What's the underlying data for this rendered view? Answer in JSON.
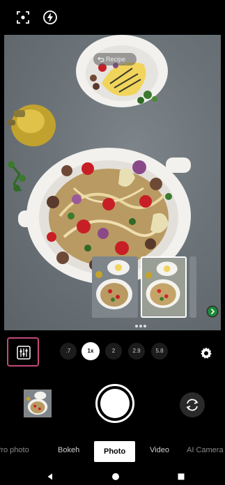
{
  "top_bar": {
    "icons": [
      "focus-frame-icon",
      "flash-auto-icon"
    ]
  },
  "viewfinder": {
    "recipe_pill_label": "Recipe",
    "thumbnail_count": 3,
    "page_dots": 3
  },
  "controls": {
    "zoom_levels": [
      ".7",
      "1x",
      "2",
      "2.9",
      "5.8"
    ],
    "active_zoom": "1x"
  },
  "modes": {
    "items": [
      "Pro photo",
      "Bokeh",
      "Photo",
      "Video",
      "AI Camera"
    ],
    "active": "Photo"
  },
  "colors": {
    "highlight_border": "#c24a7a",
    "background": "#000000"
  }
}
